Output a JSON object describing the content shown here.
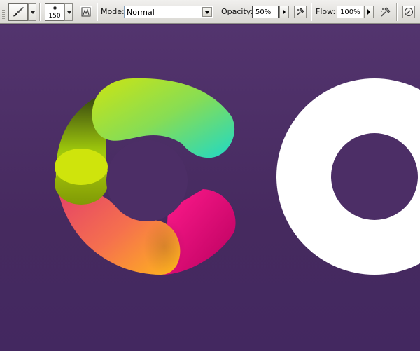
{
  "toolbar": {
    "brush_size": "150",
    "mode": {
      "label": "Mode:",
      "value": "Normal"
    },
    "opacity": {
      "label": "Opacity:",
      "value": "50%"
    },
    "flow": {
      "label": "Flow:",
      "value": "100%"
    }
  },
  "icons": {
    "tool_preset": "brush-tool-icon",
    "toggle_brushes": "toggle-brushes-panel-icon",
    "airbrush": "airbrush-icon",
    "tablet_pressure": "tablet-pressure-icon"
  },
  "colors": {
    "canvas_top": "#53346e",
    "canvas_bottom": "#432860",
    "ring_white": "#ffffff",
    "green": "#c5df13",
    "cyan": "#2adbc0",
    "magenta": "#e8007a",
    "orange": "#ffb21a"
  }
}
